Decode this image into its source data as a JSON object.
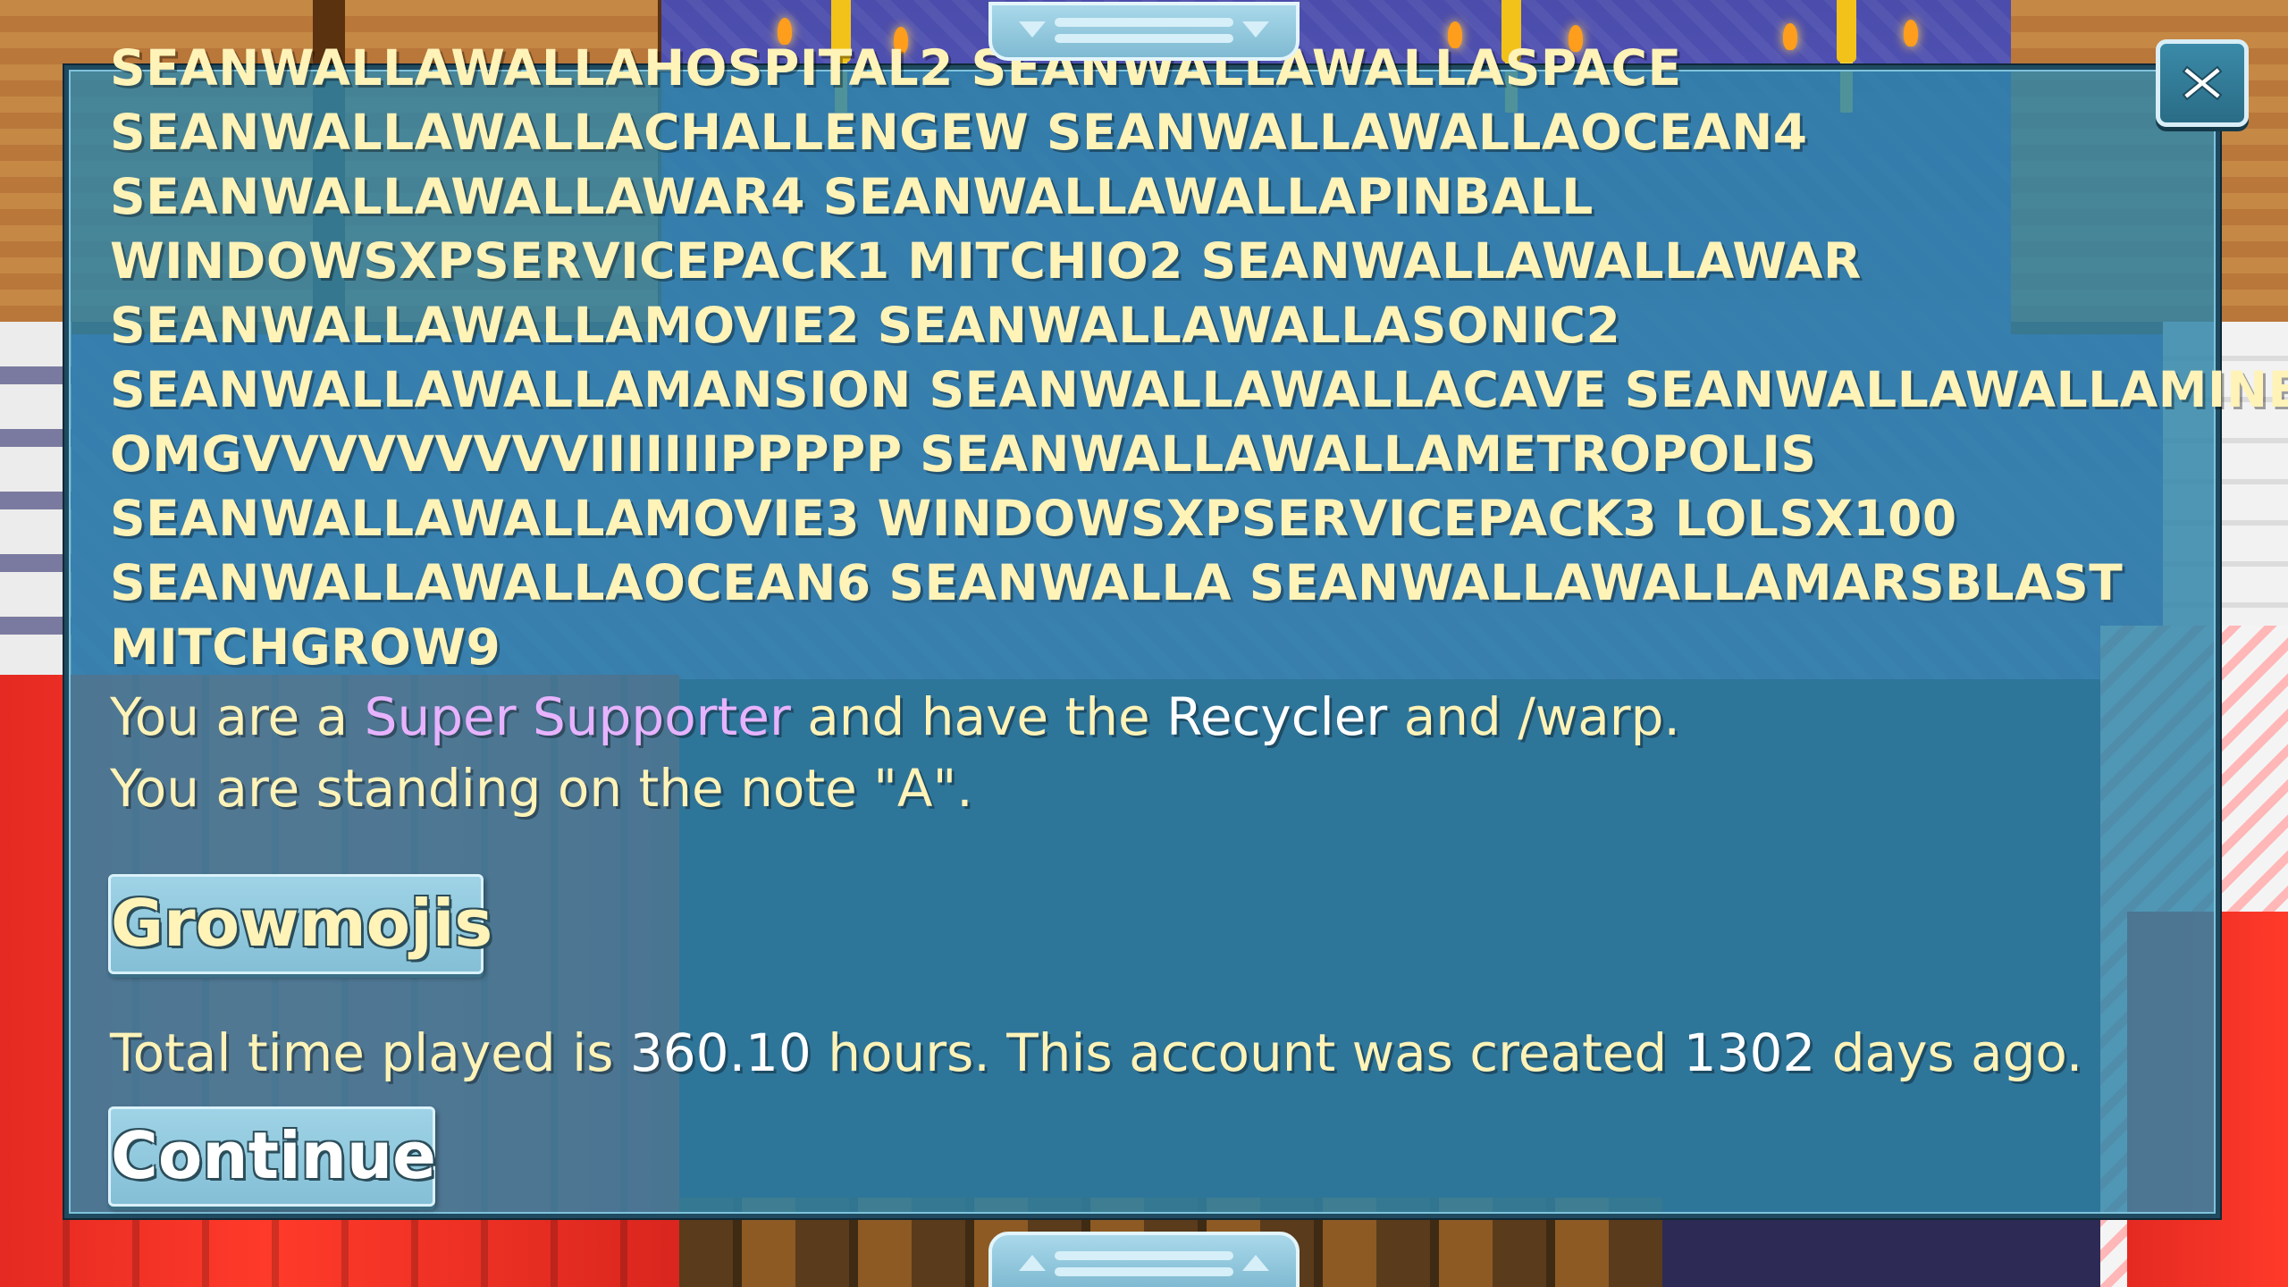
{
  "dialog": {
    "world_lines": [
      "SEANWALLAWALLAHOSPITAL2 SEANWALLAWALLASPACE",
      "SEANWALLAWALLACHALLENGEW SEANWALLAWALLAOCEAN4",
      "SEANWALLAWALLAWAR4 SEANWALLAWALLAPINBALL",
      "WINDOWSXPSERVICEPACK1 MITCHIO2 SEANWALLAWALLAWAR",
      "SEANWALLAWALLAMOVIE2 SEANWALLAWALLASONIC2",
      "SEANWALLAWALLAMANSION SEANWALLAWALLACAVE SEANWALLAWALLAMINE",
      "OMGVVVVVVVVVIIIIIIIPPPPP SEANWALLAWALLAMETROPOLIS",
      "SEANWALLAWALLAMOVIE3 WINDOWSXPSERVICEPACK3 LOLSX100",
      "SEANWALLAWALLAOCEAN6 SEANWALLA SEANWALLAWALLAMARSBLAST",
      "MITCHGROW9"
    ],
    "supporter_line": {
      "prefix": "You are a ",
      "status": "Super Supporter",
      "middle": " and have the ",
      "item": "Recycler",
      "suffix": " and /warp."
    },
    "note_line": "You are standing on the note \"A\".",
    "growmojis_label": "Growmojis",
    "time_line": {
      "prefix": "Total time played is ",
      "hours": "360.10",
      "middle": " hours.  This account was created ",
      "days": "1302",
      "suffix": " days ago."
    },
    "continue_label": "Continue"
  },
  "icons": {
    "close": "close-icon",
    "scroll_up": "chevron-down-icon",
    "scroll_down": "chevron-up-icon"
  },
  "colors": {
    "panel": "#2e84a8",
    "text": "#fff3b8",
    "highlight": "#ffffff",
    "supporter": "#e7b3ff"
  }
}
